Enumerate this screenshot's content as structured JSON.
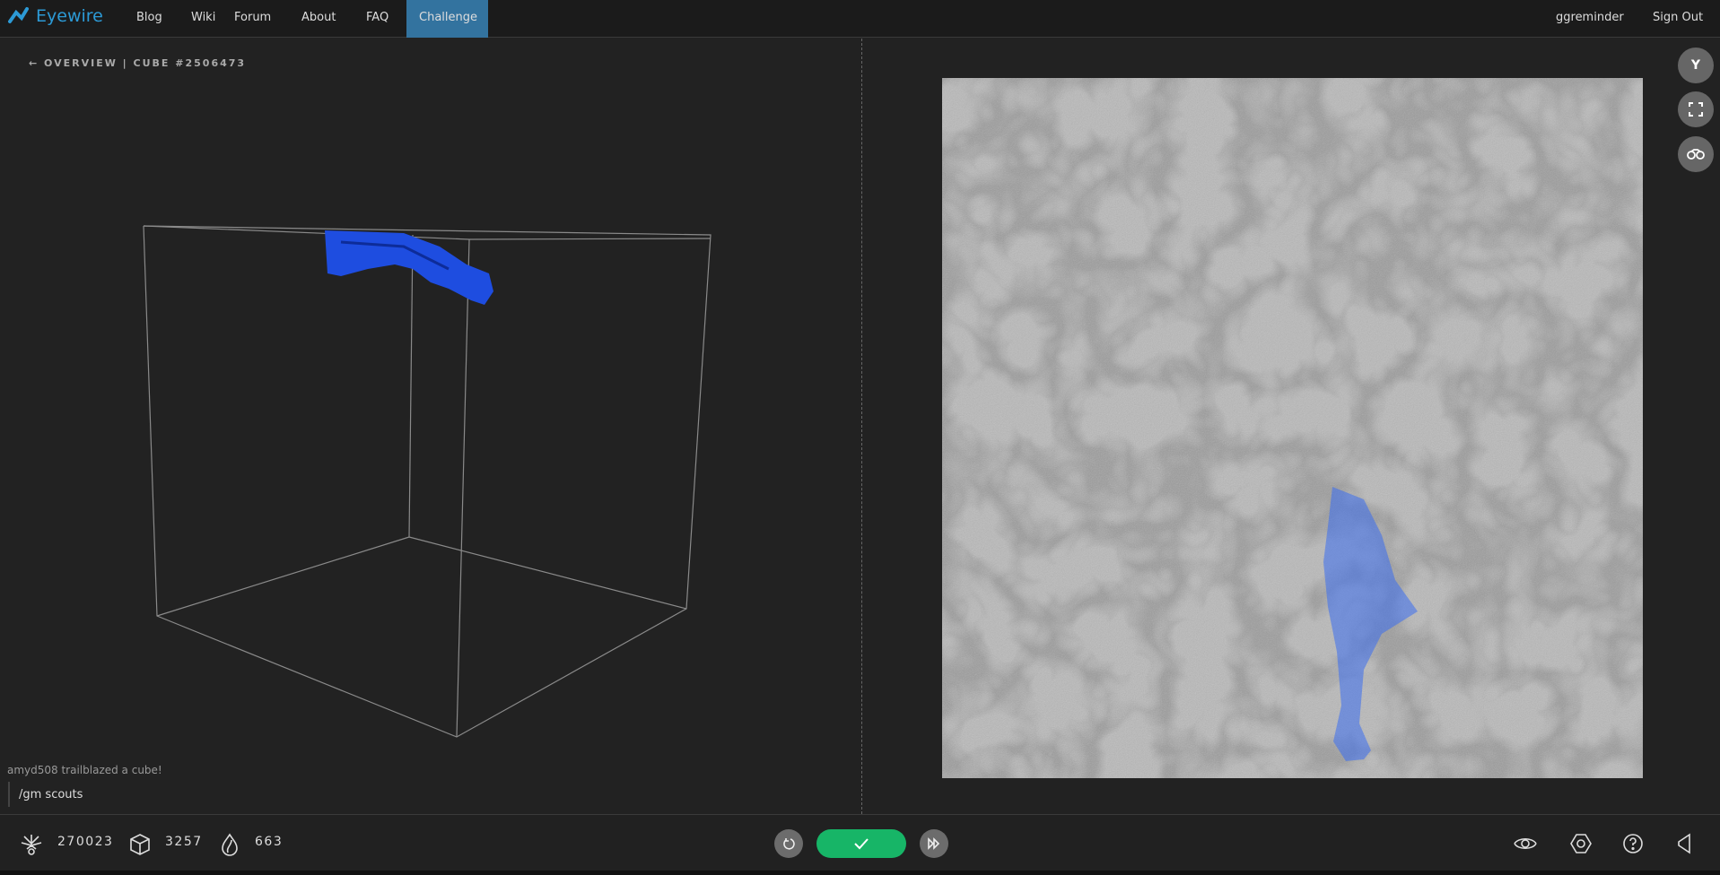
{
  "header": {
    "logo": "Eyewire",
    "nav": [
      "Blog",
      "Wiki",
      "Forum",
      "About",
      "FAQ",
      "Challenge"
    ],
    "active": "Challenge",
    "user": "ggreminder",
    "signout": "Sign Out"
  },
  "breadcrumb": "← OVERVIEW | CUBE #2506473",
  "side_buttons": {
    "y_label": "Y",
    "icons": [
      "fullscreen-icon",
      "binoculars-icon"
    ]
  },
  "chat": {
    "message": "amyd508 trailblazed a cube!",
    "input_value": "/gm scouts"
  },
  "stats": [
    {
      "icon": "neuron-icon",
      "value": "270023"
    },
    {
      "icon": "cube-icon",
      "value": "3257"
    },
    {
      "icon": "flame-icon",
      "value": "663"
    }
  ],
  "colors": {
    "accent": "#33739f",
    "logo": "#2c9ad6",
    "submit": "#17b567",
    "segment": "#1e4de0"
  }
}
